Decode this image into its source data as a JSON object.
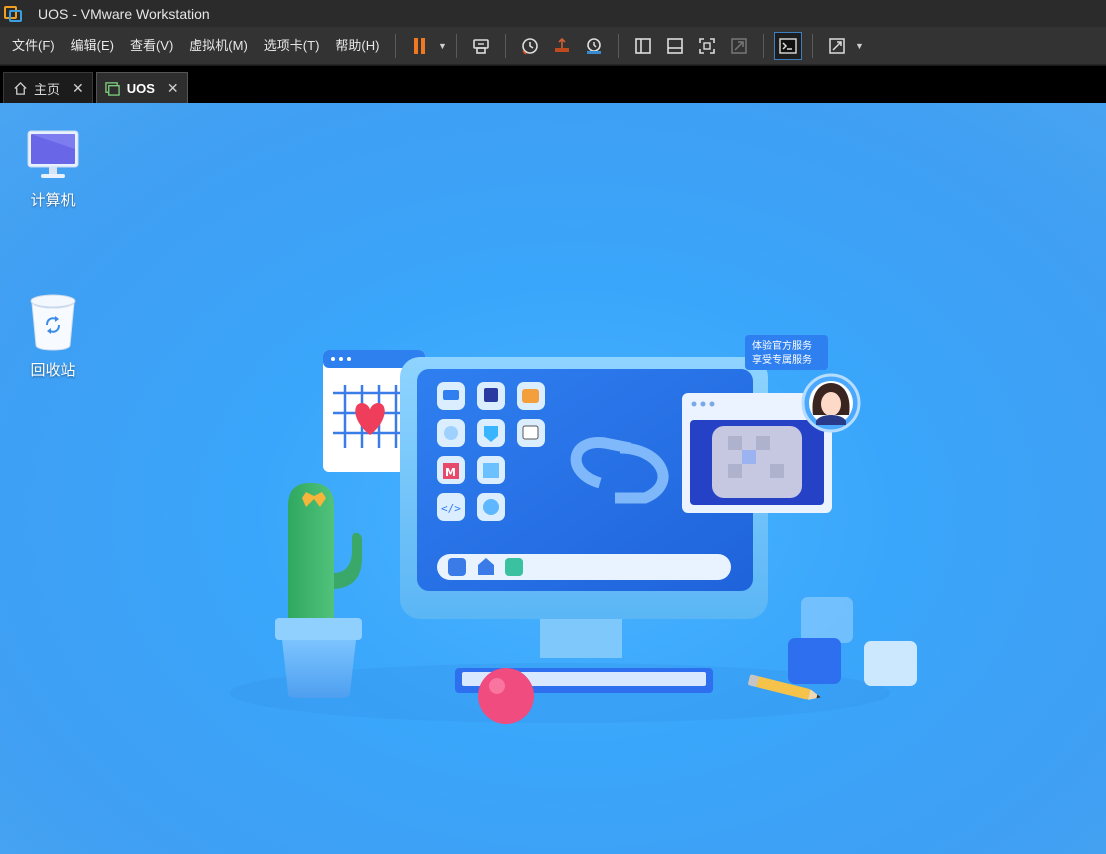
{
  "window": {
    "title": "UOS - VMware Workstation"
  },
  "menu": [
    {
      "label": "文件(F)"
    },
    {
      "label": "编辑(E)"
    },
    {
      "label": "查看(V)"
    },
    {
      "label": "虚拟机(M)"
    },
    {
      "label": "选项卡(T)"
    },
    {
      "label": "帮助(H)"
    }
  ],
  "toolbar": {
    "icons": [
      "pause-icon",
      "send-keys-icon",
      "snapshot-icon",
      "revert-snapshot-icon",
      "snapshot-manager-icon",
      "library-icon",
      "thumbnail-icon",
      "fullscreen-icon",
      "unity-icon",
      "console-icon",
      "stretch-icon"
    ],
    "pause_color": "#f07820"
  },
  "tabs": [
    {
      "label": "主页",
      "icon": "home-icon",
      "active": false
    },
    {
      "label": "UOS",
      "icon": "vm-icon",
      "active": true
    }
  ],
  "desktop": {
    "icons": [
      {
        "label": "计算机",
        "icon": "computer-icon"
      },
      {
        "label": "回收站",
        "icon": "trash-icon"
      }
    ],
    "wallpaper": {
      "bubble_line1": "体验官方服务",
      "bubble_line2": "享受专属服务"
    },
    "background_color": "#3aa6fb"
  }
}
